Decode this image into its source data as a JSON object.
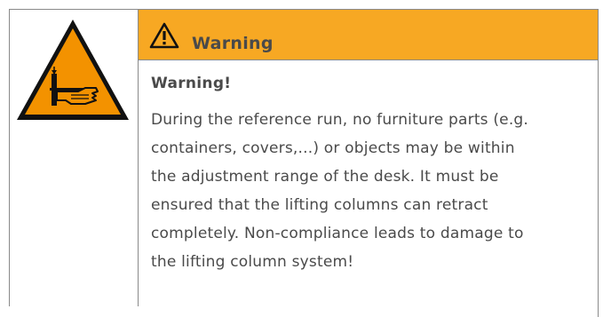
{
  "notice": {
    "header_title": "Warning",
    "heading": "Warning!",
    "text": "During the reference run, no furniture parts (e.g.\ncontainers, covers,...) or objects may be within\nthe adjustment range of the desk. It must be\nensured that the lifting columns can retract\ncompletely. Non-compliance leads to damage to\nthe lifting column system!",
    "hazard_icon": "hand-crush-warning-icon",
    "header_icon": "warning-triangle-icon"
  },
  "colors": {
    "header_background": "#f7a823",
    "sign_fill": "#f39200",
    "sign_border": "#111111",
    "text": "#4a4a4a",
    "rule": "#8a8a8a"
  }
}
